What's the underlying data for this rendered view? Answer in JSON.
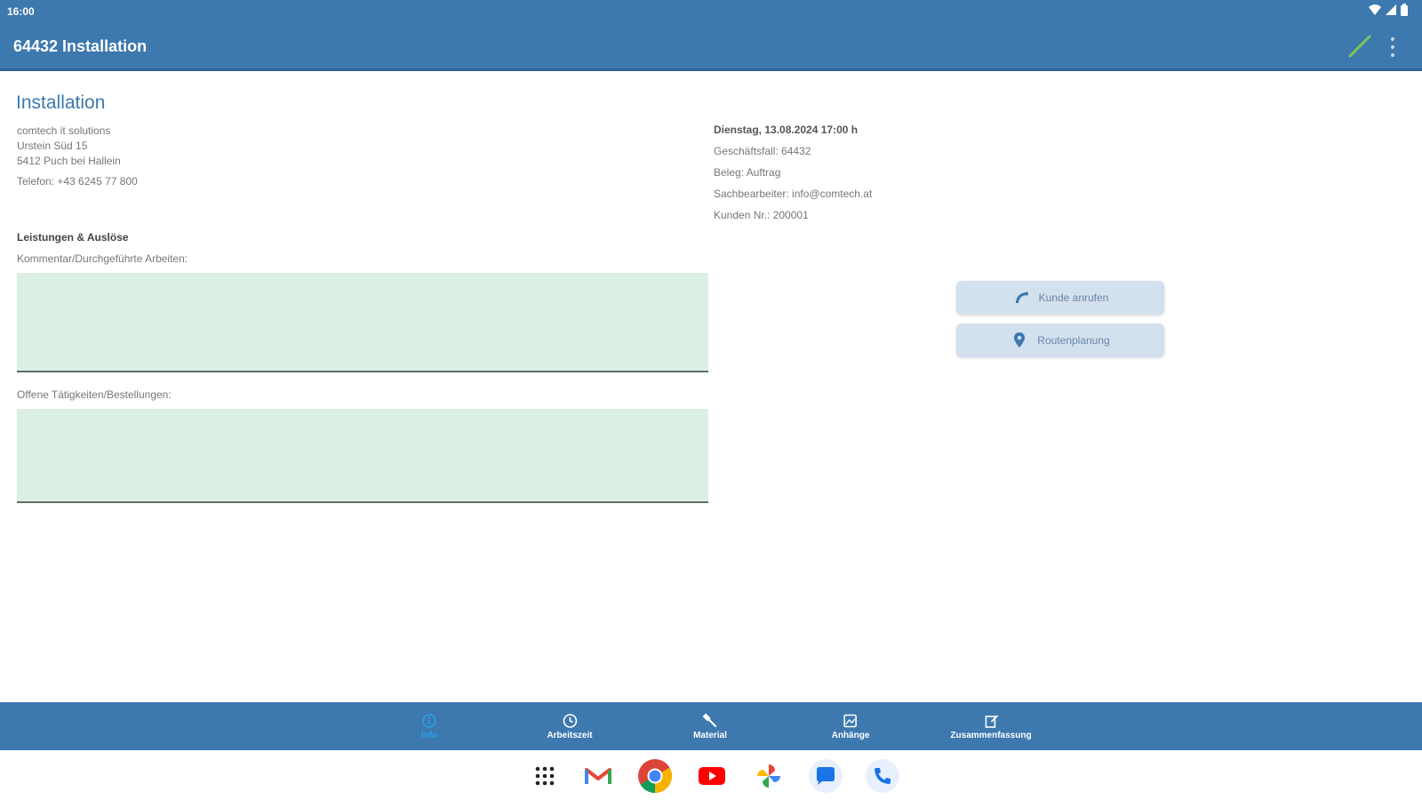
{
  "status": {
    "time": "16:00"
  },
  "appbar": {
    "title": "64432 Installation"
  },
  "job": {
    "heading": "Installation",
    "company": "comtech it solutions",
    "street": "Urstein Süd 15",
    "city": "5412 Puch bei Hallein",
    "phone": "Telefon: +43 6245 77 800"
  },
  "details": {
    "date": "Dienstag, 13.08.2024 17:00 h",
    "case": "Geschäftsfall: 64432",
    "doc": "Beleg: Auftrag",
    "clerk": "Sachbearbeiter: info@comtech.at",
    "customer": "Kunden Nr.: 200001"
  },
  "form": {
    "section": "Leistungen & Auslöse",
    "comment_label": "Kommentar/Durchgeführte Arbeiten:",
    "comment_value": "",
    "open_label": "Offene Tätigkeiten/Bestellungen:",
    "open_value": ""
  },
  "actions": {
    "call": "Kunde anrufen",
    "route": "Routenplanung"
  },
  "bottom_nav": [
    {
      "label": "Info",
      "icon": "info-icon"
    },
    {
      "label": "Arbeitszeit",
      "icon": "clock-icon"
    },
    {
      "label": "Material",
      "icon": "wrench-icon"
    },
    {
      "label": "Anhänge",
      "icon": "image-icon"
    },
    {
      "label": "Zusammenfassung",
      "icon": "summary-icon"
    }
  ],
  "dock": [
    "apps-grid-icon",
    "gmail-icon",
    "chrome-icon",
    "youtube-icon",
    "photos-icon",
    "messages-icon",
    "phone-icon"
  ],
  "colors": {
    "primary": "#3d78ae",
    "active_nav": "#2aa2e6",
    "field_bg": "#dcefe5",
    "button_bg": "#d3e0ee"
  }
}
